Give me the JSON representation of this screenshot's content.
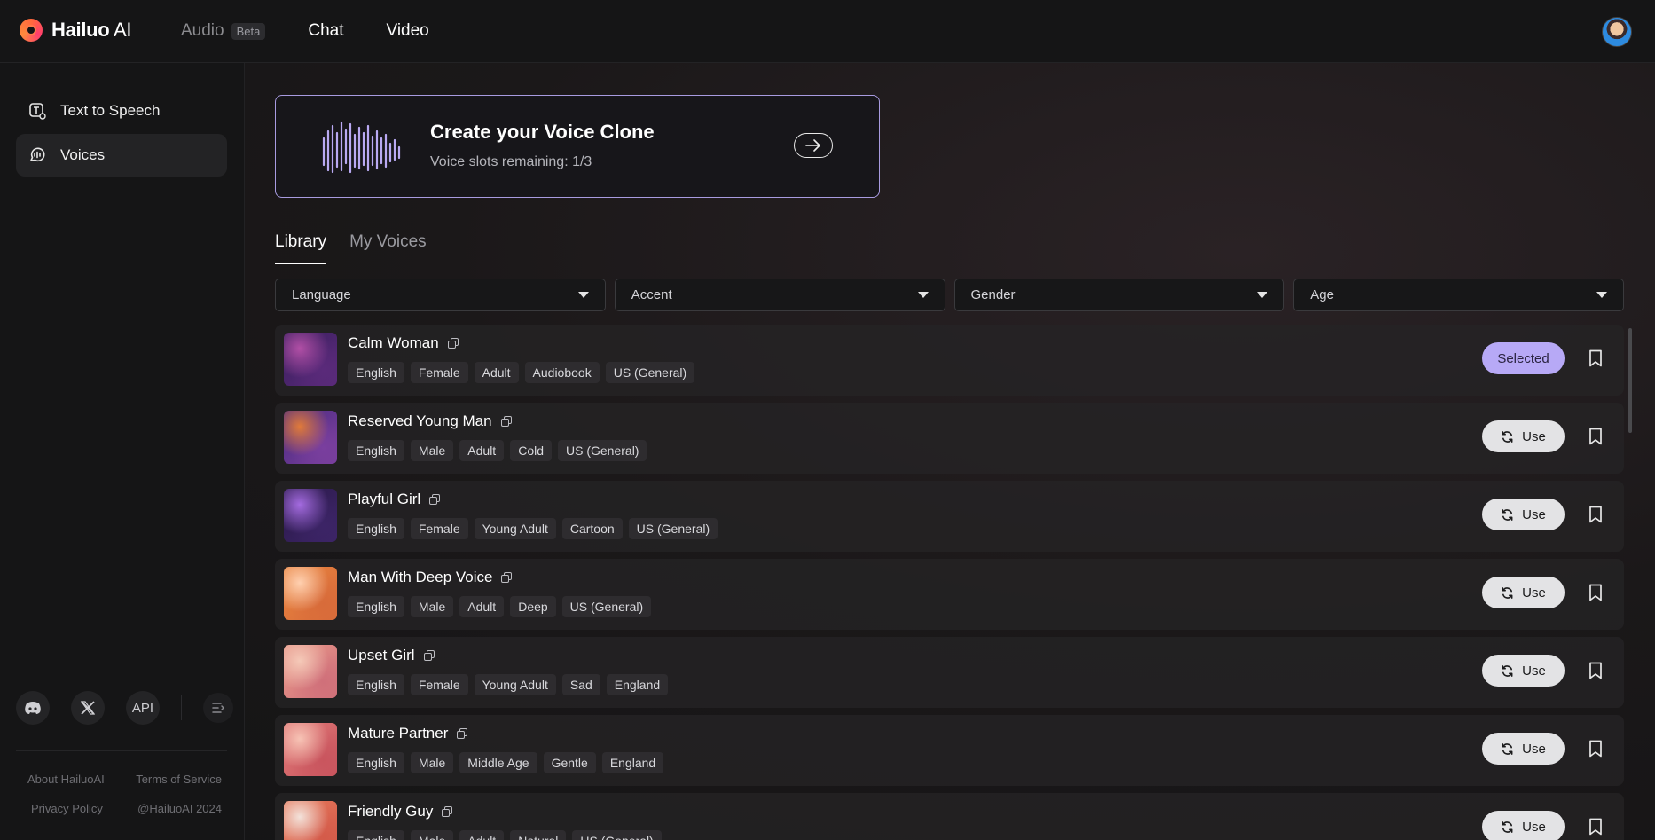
{
  "header": {
    "logo_text": "Hailuo",
    "logo_suffix": " AI",
    "nav": [
      {
        "label": "Audio",
        "badge": "Beta"
      },
      {
        "label": "Chat"
      },
      {
        "label": "Video"
      }
    ]
  },
  "sidebar": {
    "items": [
      {
        "label": "Text to Speech",
        "icon": "text-to-speech-icon"
      },
      {
        "label": "Voices",
        "icon": "voices-icon"
      }
    ],
    "social": {
      "api_label": "API"
    },
    "footer": {
      "about": "About HailuoAI",
      "terms": "Terms of Service",
      "privacy": "Privacy Policy",
      "copyright": "@HailuoAI 2024"
    }
  },
  "banner": {
    "title": "Create your Voice Clone",
    "subtitle": "Voice slots remaining: 1/3"
  },
  "tabs": [
    {
      "label": "Library",
      "active": true
    },
    {
      "label": "My Voices",
      "active": false
    }
  ],
  "filters": [
    {
      "label": "Language"
    },
    {
      "label": "Accent"
    },
    {
      "label": "Gender"
    },
    {
      "label": "Age"
    }
  ],
  "buttons": {
    "selected": "Selected",
    "use": "Use"
  },
  "voices": [
    {
      "name": "Calm Woman",
      "tags": [
        "English",
        "Female",
        "Adult",
        "Audiobook",
        "US (General)"
      ],
      "selected": true,
      "colors": [
        "#3a1f5e",
        "#b14fa6",
        "#5a2a7a"
      ]
    },
    {
      "name": "Reserved Young Man",
      "tags": [
        "English",
        "Male",
        "Adult",
        "Cold",
        "US (General)"
      ],
      "selected": false,
      "colors": [
        "#4b2b7f",
        "#e07a3a",
        "#7a3f9e"
      ]
    },
    {
      "name": "Playful Girl",
      "tags": [
        "English",
        "Female",
        "Young Adult",
        "Cartoon",
        "US (General)"
      ],
      "selected": false,
      "colors": [
        "#2b1a4a",
        "#a46be0",
        "#3c2466"
      ]
    },
    {
      "name": "Man With Deep Voice",
      "tags": [
        "English",
        "Male",
        "Adult",
        "Deep",
        "US (General)"
      ],
      "selected": false,
      "colors": [
        "#e8843f",
        "#ffd0b0",
        "#d86b3a"
      ]
    },
    {
      "name": "Upset Girl",
      "tags": [
        "English",
        "Female",
        "Young Adult",
        "Sad",
        "England"
      ],
      "selected": false,
      "colors": [
        "#e8998a",
        "#f5c9b8",
        "#d0707a"
      ]
    },
    {
      "name": "Mature Partner",
      "tags": [
        "English",
        "Male",
        "Middle Age",
        "Gentle",
        "England"
      ],
      "selected": false,
      "colors": [
        "#e07a78",
        "#f7c3b5",
        "#c9555e"
      ]
    },
    {
      "name": "Friendly Guy",
      "tags": [
        "English",
        "Male",
        "Adult",
        "Natural",
        "US (General)"
      ],
      "selected": false,
      "colors": [
        "#e67a5c",
        "#f3e2da",
        "#d45b4a"
      ]
    }
  ]
}
